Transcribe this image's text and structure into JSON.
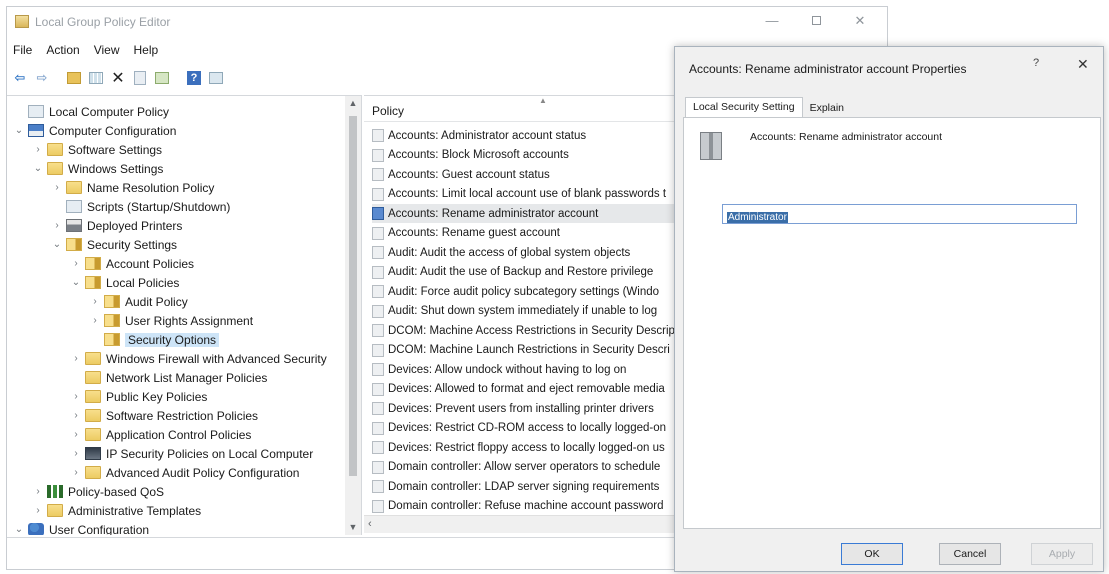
{
  "window": {
    "title": "Local Group Policy Editor"
  },
  "menu": [
    "File",
    "Action",
    "View",
    "Help"
  ],
  "tree": [
    {
      "label": "Local Computer Policy",
      "chevron": "",
      "icon": "scripts"
    },
    {
      "label": "Computer Configuration",
      "chevron": "⌄",
      "icon": "computer"
    },
    {
      "label": "Software Settings",
      "chevron": "›",
      "icon": "folder"
    },
    {
      "label": "Windows Settings",
      "chevron": "⌄",
      "icon": "folder"
    },
    {
      "label": "Name Resolution Policy",
      "chevron": "›",
      "icon": "folder"
    },
    {
      "label": "Scripts (Startup/Shutdown)",
      "chevron": "",
      "icon": "scripts"
    },
    {
      "label": "Deployed Printers",
      "chevron": "›",
      "icon": "printer"
    },
    {
      "label": "Security Settings",
      "chevron": "⌄",
      "icon": "folder-shield"
    },
    {
      "label": "Account Policies",
      "chevron": "›",
      "icon": "folder-shield"
    },
    {
      "label": "Local Policies",
      "chevron": "⌄",
      "icon": "folder-shield"
    },
    {
      "label": "Audit Policy",
      "chevron": "›",
      "icon": "folder-shield"
    },
    {
      "label": "User Rights Assignment",
      "chevron": "›",
      "icon": "folder-shield"
    },
    {
      "label": "Security Options",
      "chevron": "",
      "icon": "folder-shield",
      "selected": true
    },
    {
      "label": "Windows Firewall with Advanced Security",
      "chevron": "›",
      "icon": "folder"
    },
    {
      "label": "Network List Manager Policies",
      "chevron": "",
      "icon": "folder"
    },
    {
      "label": "Public Key Policies",
      "chevron": "›",
      "icon": "folder"
    },
    {
      "label": "Software Restriction Policies",
      "chevron": "›",
      "icon": "folder"
    },
    {
      "label": "Application Control Policies",
      "chevron": "›",
      "icon": "folder"
    },
    {
      "label": "IP Security Policies on Local Computer",
      "chevron": "›",
      "icon": "ipsec"
    },
    {
      "label": "Advanced Audit Policy Configuration",
      "chevron": "›",
      "icon": "folder"
    },
    {
      "label": "Policy-based QoS",
      "chevron": "›",
      "icon": "chart"
    },
    {
      "label": "Administrative Templates",
      "chevron": "›",
      "icon": "folder"
    },
    {
      "label": "User Configuration",
      "chevron": "⌄",
      "icon": "user"
    }
  ],
  "list": {
    "header": "Policy",
    "items": [
      {
        "label": "Accounts: Administrator account status"
      },
      {
        "label": "Accounts: Block Microsoft accounts"
      },
      {
        "label": "Accounts: Guest account status"
      },
      {
        "label": "Accounts: Limit local account use of blank passwords t"
      },
      {
        "label": "Accounts: Rename administrator account",
        "selected": true
      },
      {
        "label": "Accounts: Rename guest account"
      },
      {
        "label": "Audit: Audit the access of global system objects"
      },
      {
        "label": "Audit: Audit the use of Backup and Restore privilege"
      },
      {
        "label": "Audit: Force audit policy subcategory settings (Windo"
      },
      {
        "label": "Audit: Shut down system immediately if unable to log"
      },
      {
        "label": "DCOM: Machine Access Restrictions in Security Descrip"
      },
      {
        "label": "DCOM: Machine Launch Restrictions in Security Descri"
      },
      {
        "label": "Devices: Allow undock without having to log on"
      },
      {
        "label": "Devices: Allowed to format and eject removable media"
      },
      {
        "label": "Devices: Prevent users from installing printer drivers"
      },
      {
        "label": "Devices: Restrict CD-ROM access to locally logged-on"
      },
      {
        "label": "Devices: Restrict floppy access to locally logged-on us"
      },
      {
        "label": "Domain controller: Allow server operators to schedule"
      },
      {
        "label": "Domain controller: LDAP server signing requirements"
      },
      {
        "label": "Domain controller: Refuse machine account password"
      }
    ]
  },
  "dialog": {
    "title": "Accounts: Rename administrator account Properties",
    "help_glyph": "?",
    "close_glyph": "✕",
    "tabs": [
      "Local Security Setting",
      "Explain"
    ],
    "policy_name": "Accounts: Rename administrator account",
    "value": "Administrator",
    "ok_label": "OK",
    "cancel_label": "Cancel",
    "apply_label": "Apply"
  },
  "icons": {
    "back": "back-arrow-icon",
    "forward": "forward-arrow-icon",
    "up": "folder-up-icon",
    "show_tree": "show-tree-icon",
    "delete": "delete-icon",
    "properties": "properties-icon",
    "export": "export-list-icon",
    "help": "help-icon",
    "mmc": "mmc-icon"
  }
}
